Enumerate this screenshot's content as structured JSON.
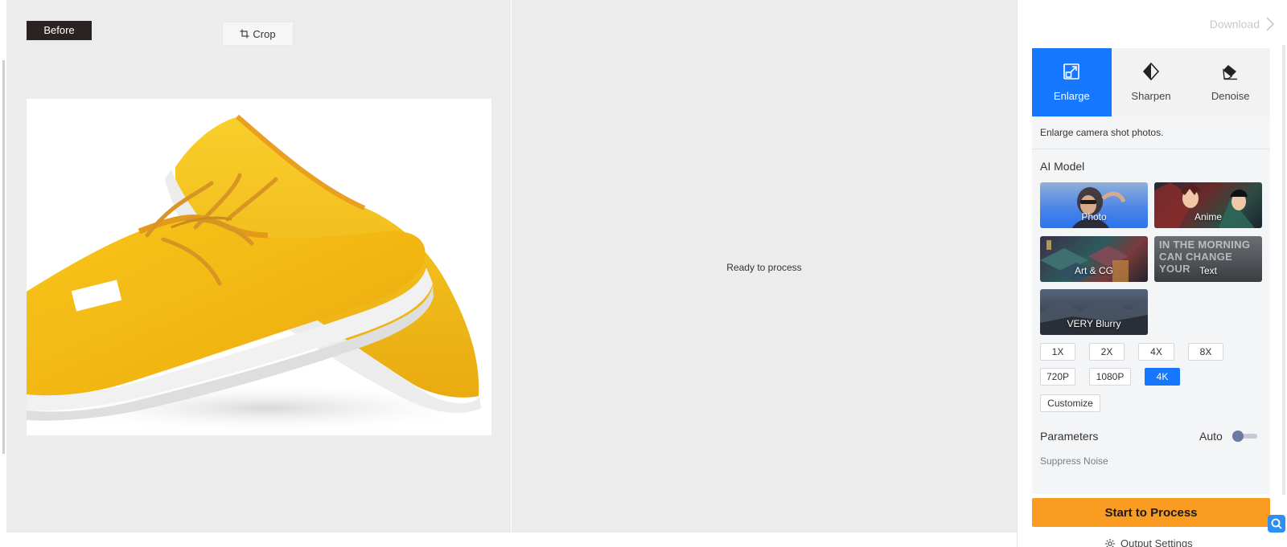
{
  "before_pane": {
    "tag": "Before",
    "crop_label": "Crop"
  },
  "after_pane": {
    "status": "Ready to process"
  },
  "panel": {
    "download_label": "Download",
    "modes": [
      {
        "label": "Enlarge",
        "icon": "enlarge-icon",
        "active": true
      },
      {
        "label": "Sharpen",
        "icon": "sharpen-icon",
        "active": false
      },
      {
        "label": "Denoise",
        "icon": "denoise-icon",
        "active": false
      }
    ],
    "description": "Enlarge camera shot photos.",
    "ai_model_label": "AI Model",
    "models": [
      {
        "label": "Photo",
        "selected": true
      },
      {
        "label": "Anime"
      },
      {
        "label": "Art & CG"
      },
      {
        "label": "Text",
        "preview_text": "IN THE MORNING CAN CHANGE YOUR"
      },
      {
        "label": "VERY Blurry"
      }
    ],
    "scales": {
      "multipliers": [
        "1X",
        "2X",
        "4X",
        "8X"
      ],
      "resolutions": [
        "720P",
        "1080P",
        "4K"
      ],
      "selected": "4K",
      "customize": "Customize"
    },
    "parameters_label": "Parameters",
    "auto_label": "Auto",
    "suppress_noise_label": "Suppress Noise",
    "start_button": "Start to Process",
    "output_settings": "Output Settings"
  },
  "colors": {
    "accent_blue": "#1677ff",
    "start_orange": "#fa9c22",
    "before_tag_bg": "#2b2321",
    "canvas_bg": "#ececec"
  }
}
